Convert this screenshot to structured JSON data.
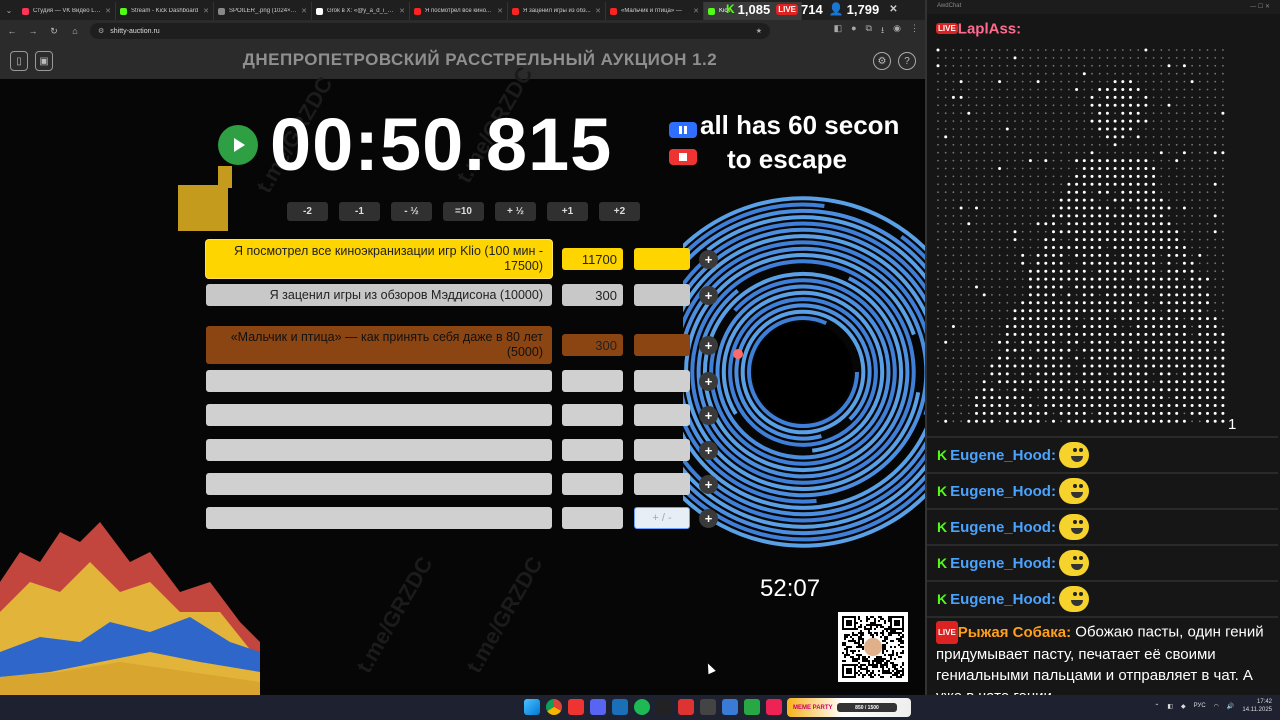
{
  "browser": {
    "tabs": [
      {
        "title": "Студия — VK Видео Live",
        "color": "#ff3355"
      },
      {
        "title": "Stream - Kick Dashboard",
        "color": "#53fc18"
      },
      {
        "title": "SPOILER_.png (1024×1024)",
        "color": "#888888"
      },
      {
        "title": "Grok в X: «@y_a_d_i_m»",
        "color": "#ffffff"
      },
      {
        "title": "Я посмотрел все кино...",
        "color": "#ff2222"
      },
      {
        "title": "Я заценил игры из обз...",
        "color": "#ff2222"
      },
      {
        "title": "«Мальчик и птица» —",
        "color": "#ff2222"
      },
      {
        "title": "Kick",
        "color": "#53fc18"
      }
    ],
    "url": "shitty-auction.ru"
  },
  "overlay": {
    "kick_viewers": "1,085",
    "vk_viewers": "714",
    "total_viewers": "1,799"
  },
  "app": {
    "title": "ДНЕПРОПЕТРОВСКИЙ РАССТРЕЛЬНЫЙ АУКЦИОН 1.2",
    "timer": "00:50.815",
    "marquee_line1": "all has 60 secon",
    "marquee_line2": "to escape",
    "time_buttons": [
      "-2",
      "-1",
      "- ½",
      "=10",
      "+ ½",
      "+1",
      "+2"
    ],
    "lots": [
      {
        "name": "Я посмотрел все киноэкранизации игр Klio (100 мин - 17500)",
        "amount": "11700",
        "extra": "",
        "color": "#ffd500"
      },
      {
        "name": "Я заценил игры из обзоров Мэддисона (10000)",
        "amount": "300",
        "extra": "",
        "color": "#c8c8c8"
      },
      {
        "name": "«Мальчик и птица» — как принять себя даже в 80 лет (5000)",
        "amount": "300",
        "extra": "",
        "color": "#8b4513"
      },
      {
        "name": "",
        "amount": "",
        "extra": "",
        "color": "#d0d0d0"
      },
      {
        "name": "",
        "amount": "",
        "extra": "",
        "color": "#d0d0d0"
      },
      {
        "name": "",
        "amount": "",
        "extra": "",
        "color": "#d0d0d0"
      },
      {
        "name": "",
        "amount": "",
        "extra": "",
        "color": "#d0d0d0"
      },
      {
        "name": "",
        "amount": "",
        "extra": "+ / -",
        "color": "#d0d0d0"
      }
    ],
    "plus_label": "+",
    "wheel_time": "52:07"
  },
  "chat": {
    "messages": [
      {
        "user": "LaplAss:",
        "platform": "vk",
        "text": ""
      },
      {
        "user": "Eugene_Hood:",
        "platform": "kick",
        "text": ""
      },
      {
        "user": "Eugene_Hood:",
        "platform": "kick",
        "text": ""
      },
      {
        "user": "Eugene_Hood:",
        "platform": "kick",
        "text": ""
      },
      {
        "user": "Eugene_Hood:",
        "platform": "kick",
        "text": ""
      },
      {
        "user": "Eugene_Hood:",
        "platform": "kick",
        "text": ""
      },
      {
        "user": "Рыжая Собака:",
        "platform": "vk",
        "text": "Обожаю пасты, один гений придумывает пасту, печатает её своими гениальными пальцами и отправляет в чат. А уже в чате гении"
      }
    ],
    "braille_suffix": "1",
    "live_badge": "LIVE",
    "kick_badge": "K"
  },
  "taskbar": {
    "meme_label": "MEME PARTY",
    "meme_progress": "850 / 1500",
    "lang": "РУС",
    "time": "17:42",
    "date": "14.11.2025"
  }
}
